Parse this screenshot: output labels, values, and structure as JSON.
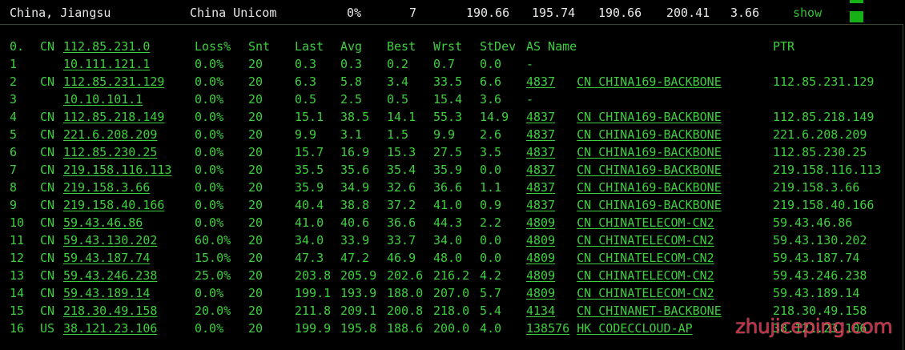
{
  "summary": {
    "location": "China, Jiangsu",
    "isp": "China Unicom",
    "loss": "0%",
    "sent": "7",
    "last": "190.66",
    "avg": "195.74",
    "best": "190.66",
    "worst": "200.41",
    "stdev": "3.66",
    "show_label": "show",
    "accent": "#17b017"
  },
  "headers": {
    "hop": "0.",
    "cc": "CN",
    "host": "112.85.231.0",
    "loss": "Loss%",
    "snt": "Snt",
    "last": "Last",
    "avg": "Avg",
    "best": "Best",
    "wrst": "Wrst",
    "stdev": "StDev",
    "asname": "AS Name",
    "ptr": "PTR"
  },
  "hops": [
    {
      "hop": "1",
      "cc": "",
      "host": "10.111.121.1",
      "loss": "0.0%",
      "snt": "20",
      "last": "0.3",
      "avg": "0.3",
      "best": "0.2",
      "wrst": "0.7",
      "stdev": "0.0",
      "asn": "",
      "asname": "-",
      "ptr": ""
    },
    {
      "hop": "2",
      "cc": "CN",
      "host": "112.85.231.129",
      "loss": "0.0%",
      "snt": "20",
      "last": "6.3",
      "avg": "5.8",
      "best": "3.4",
      "wrst": "33.5",
      "stdev": "6.6",
      "asn": "4837",
      "asname": "CN CHINA169-BACKBONE",
      "ptr": "112.85.231.129"
    },
    {
      "hop": "3",
      "cc": "",
      "host": "10.10.101.1",
      "loss": "0.0%",
      "snt": "20",
      "last": "0.5",
      "avg": "2.5",
      "best": "0.5",
      "wrst": "15.4",
      "stdev": "3.6",
      "asn": "",
      "asname": "-",
      "ptr": ""
    },
    {
      "hop": "4",
      "cc": "CN",
      "host": "112.85.218.149",
      "loss": "0.0%",
      "snt": "20",
      "last": "15.1",
      "avg": "38.5",
      "best": "14.1",
      "wrst": "55.3",
      "stdev": "14.9",
      "asn": "4837",
      "asname": "CN CHINA169-BACKBONE",
      "ptr": "112.85.218.149"
    },
    {
      "hop": "5",
      "cc": "CN",
      "host": "221.6.208.209",
      "loss": "0.0%",
      "snt": "20",
      "last": "9.9",
      "avg": "3.1",
      "best": "1.5",
      "wrst": "9.9",
      "stdev": "2.6",
      "asn": "4837",
      "asname": "CN CHINA169-BACKBONE",
      "ptr": "221.6.208.209"
    },
    {
      "hop": "6",
      "cc": "CN",
      "host": "112.85.230.25",
      "loss": "0.0%",
      "snt": "20",
      "last": "15.7",
      "avg": "16.9",
      "best": "15.3",
      "wrst": "27.5",
      "stdev": "3.5",
      "asn": "4837",
      "asname": "CN CHINA169-BACKBONE",
      "ptr": "112.85.230.25"
    },
    {
      "hop": "7",
      "cc": "CN",
      "host": "219.158.116.113",
      "loss": "0.0%",
      "snt": "20",
      "last": "35.5",
      "avg": "35.6",
      "best": "35.4",
      "wrst": "35.9",
      "stdev": "0.0",
      "asn": "4837",
      "asname": "CN CHINA169-BACKBONE",
      "ptr": "219.158.116.113"
    },
    {
      "hop": "8",
      "cc": "CN",
      "host": "219.158.3.66",
      "loss": "0.0%",
      "snt": "20",
      "last": "35.9",
      "avg": "34.9",
      "best": "32.6",
      "wrst": "36.6",
      "stdev": "1.1",
      "asn": "4837",
      "asname": "CN CHINA169-BACKBONE",
      "ptr": "219.158.3.66"
    },
    {
      "hop": "9",
      "cc": "CN",
      "host": "219.158.40.166",
      "loss": "0.0%",
      "snt": "20",
      "last": "40.4",
      "avg": "38.8",
      "best": "37.2",
      "wrst": "41.0",
      "stdev": "0.9",
      "asn": "4837",
      "asname": "CN CHINA169-BACKBONE",
      "ptr": "219.158.40.166"
    },
    {
      "hop": "10",
      "cc": "CN",
      "host": "59.43.46.86",
      "loss": "0.0%",
      "snt": "20",
      "last": "41.0",
      "avg": "40.6",
      "best": "36.6",
      "wrst": "44.3",
      "stdev": "2.2",
      "asn": "4809",
      "asname": "CN CHINATELECOM-CN2",
      "ptr": "59.43.46.86"
    },
    {
      "hop": "11",
      "cc": "CN",
      "host": "59.43.130.202",
      "loss": "60.0%",
      "snt": "20",
      "last": "34.0",
      "avg": "33.9",
      "best": "33.7",
      "wrst": "34.0",
      "stdev": "0.0",
      "asn": "4809",
      "asname": "CN CHINATELECOM-CN2",
      "ptr": "59.43.130.202"
    },
    {
      "hop": "12",
      "cc": "CN",
      "host": "59.43.187.74",
      "loss": "15.0%",
      "snt": "20",
      "last": "47.3",
      "avg": "47.2",
      "best": "46.9",
      "wrst": "48.0",
      "stdev": "0.0",
      "asn": "4809",
      "asname": "CN CHINATELECOM-CN2",
      "ptr": "59.43.187.74"
    },
    {
      "hop": "13",
      "cc": "CN",
      "host": "59.43.246.238",
      "loss": "25.0%",
      "snt": "20",
      "last": "203.8",
      "avg": "205.9",
      "best": "202.6",
      "wrst": "216.2",
      "stdev": "4.2",
      "asn": "4809",
      "asname": "CN CHINATELECOM-CN2",
      "ptr": "59.43.246.238"
    },
    {
      "hop": "14",
      "cc": "CN",
      "host": "59.43.189.14",
      "loss": "0.0%",
      "snt": "20",
      "last": "199.1",
      "avg": "193.9",
      "best": "188.0",
      "wrst": "207.0",
      "stdev": "5.7",
      "asn": "4809",
      "asname": "CN CHINATELECOM-CN2",
      "ptr": "59.43.189.14"
    },
    {
      "hop": "15",
      "cc": "CN",
      "host": "218.30.49.158",
      "loss": "20.0%",
      "snt": "20",
      "last": "211.8",
      "avg": "209.1",
      "best": "200.8",
      "wrst": "218.0",
      "stdev": "5.4",
      "asn": "4134",
      "asname": "CN CHINANET-BACKBONE",
      "ptr": "218.30.49.158"
    },
    {
      "hop": "16",
      "cc": "US",
      "host": "38.121.23.106",
      "loss": "0.0%",
      "snt": "20",
      "last": "199.9",
      "avg": "195.8",
      "best": "188.6",
      "wrst": "200.0",
      "stdev": "4.0",
      "asn": "138576",
      "asname": "HK CODECCLOUD-AP",
      "ptr": "38.121.23.106"
    }
  ],
  "watermark": "zhujiceping.com"
}
